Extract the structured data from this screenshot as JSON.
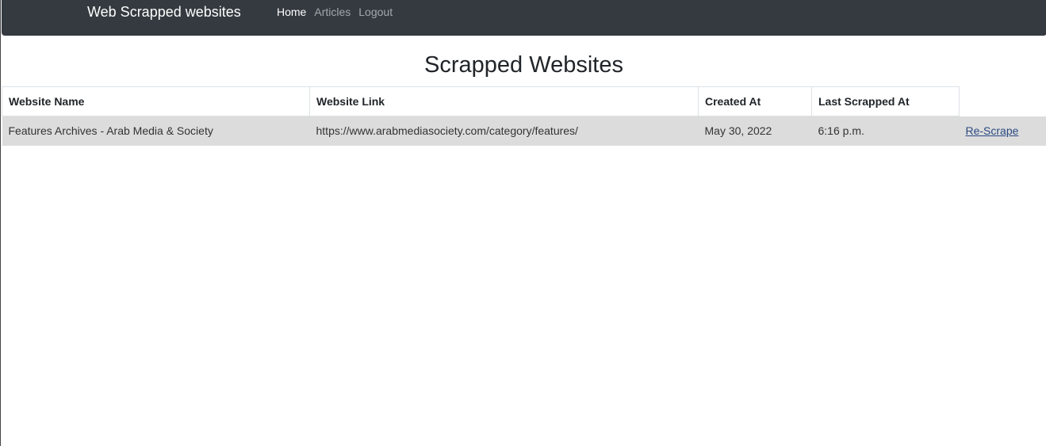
{
  "navbar": {
    "brand": "Web Scrapped websites",
    "links": [
      {
        "label": "Home",
        "active": true
      },
      {
        "label": "Articles",
        "active": false
      },
      {
        "label": "Logout",
        "active": false
      }
    ]
  },
  "main": {
    "title": "Scrapped Websites",
    "table": {
      "headers": [
        "Website Name",
        "Website Link",
        "Created At",
        "Last Scrapped At"
      ],
      "rows": [
        {
          "name": "Features Archives - Arab Media & Society",
          "link": "https://www.arabmediasociety.com/category/features/",
          "created_at": "May 30, 2022",
          "last_scrapped_at": "6:16 p.m.",
          "action": "Re-Scrape"
        }
      ]
    }
  },
  "colors": {
    "navbar_bg": "#343a40",
    "row_bg": "#dcdcdc",
    "link": "#2a4a80"
  }
}
